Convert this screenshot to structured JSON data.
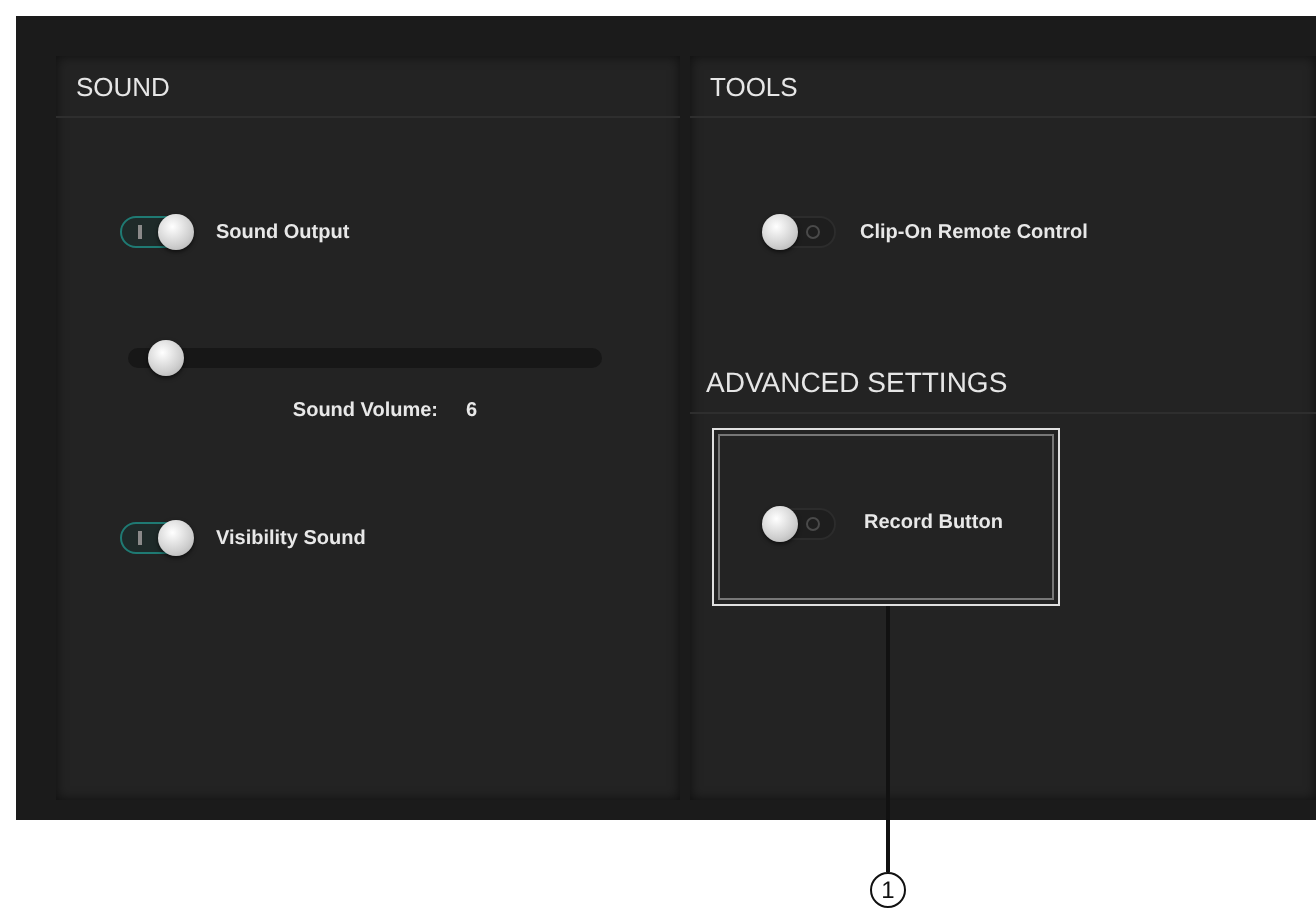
{
  "sound": {
    "title": "SOUND",
    "items": [
      {
        "kind": "toggle",
        "label": "Sound Output",
        "on": true
      },
      {
        "kind": "slider",
        "level": 0.08,
        "label": "Sound Volume:",
        "value": "6"
      },
      {
        "kind": "toggle",
        "label": "Visibility Sound",
        "on": true
      }
    ]
  },
  "tools": {
    "title": "TOOLS",
    "items": [
      {
        "kind": "toggle",
        "label": "Clip-On Remote Control",
        "on": false
      }
    ]
  },
  "advanced": {
    "title": "ADVANCED SETTINGS",
    "items": [
      {
        "kind": "toggle",
        "label": "Record Button",
        "on": false,
        "callout": "1"
      }
    ]
  }
}
